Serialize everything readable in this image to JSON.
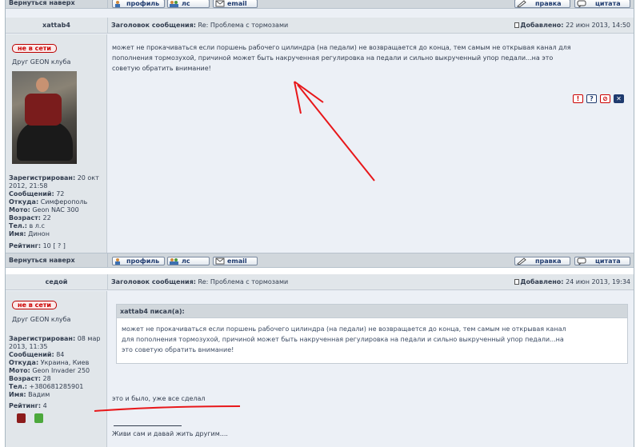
{
  "top_bar": {
    "back_label": "Вернуться наверх",
    "profile_label": "профиль",
    "pm_label": "лс",
    "email_label": "email",
    "edit_label": "правка",
    "quote_label": "цитата"
  },
  "post1": {
    "author": "xattab4",
    "subject_label": "Заголовок сообщения:",
    "subject": "Re: Проблема с тормозами",
    "posted_label": "Добавлено:",
    "date": "22 июн 2013, 14:50",
    "online_badge": "не в сети",
    "rank": "Друг GEON клуба",
    "registered_label": "Зарегистрирован:",
    "registered": "20 окт 2012, 21:58",
    "messages_label": "Сообщений:",
    "messages": "72",
    "from_label": "Откуда:",
    "from": "Симферополь",
    "moto_label": "Мото:",
    "moto": "Geon NAC 300",
    "age_label": "Возраст:",
    "age": "22",
    "phone_label": "Тел.:",
    "phone": "в л.с",
    "name_label": "Имя:",
    "name": "Динон",
    "rating_label": "Рейтинг:",
    "rating": "10 [ ? ]",
    "text_line1": "может не прокачиваться если поршень рабочего цилиндра (на педали) не возвращается до конца, тем самым не открывая канал для",
    "text_line2": "пополнения тормозухой, причиной может быть накрученная регулировка на педали и сильно выкрученный упор педали...на это",
    "text_line3": "советую обратить внимание!",
    "tools": [
      "!",
      "?",
      "⊘",
      "✕"
    ]
  },
  "mid_bar": {
    "back_label": "Вернуться наверх",
    "profile_label": "профиль",
    "pm_label": "лс",
    "email_label": "email",
    "edit_label": "правка",
    "quote_label": "цитата"
  },
  "post2": {
    "author": "седой",
    "subject_label": "Заголовок сообщения:",
    "subject": "Re: Проблема с тормозами",
    "posted_label": "Добавлено:",
    "date": "24 июн 2013, 19:34",
    "online_badge": "не в сети",
    "rank": "Друг GEON клуба",
    "registered_label": "Зарегистрирован:",
    "registered": "08 мар 2013, 11:35",
    "messages_label": "Сообщений:",
    "messages": "84",
    "from_label": "Откуда:",
    "from": "Украина, Киев",
    "moto_label": "Мото:",
    "moto": "Geon Invader 250",
    "age_label": "Возраст:",
    "age": "28",
    "phone_label": "Тел.:",
    "phone": "+380681285901",
    "name_label": "Имя:",
    "name": "Вадим",
    "rating_label": "Рейтинг:",
    "rating": "4",
    "quote_author": "xattab4 писал(а):",
    "quote_line1": "может не прокачиваться если поршень рабочего цилиндра (на педали) не возвращается до конца, тем самым не открывая канал",
    "quote_line2": "для пополнения тормозухой, причиной может быть накрученная регулировка на педали и сильно выкрученный упор педали...на",
    "quote_line3": "это советую обратить внимание!",
    "reply": "это и было, уже все сделал",
    "signature": "Живи сам и давай жить другим...."
  },
  "colors": {
    "annotation_red": "#e8171a",
    "link_blue": "#1e3a6e",
    "offline_red": "#cc0000"
  }
}
